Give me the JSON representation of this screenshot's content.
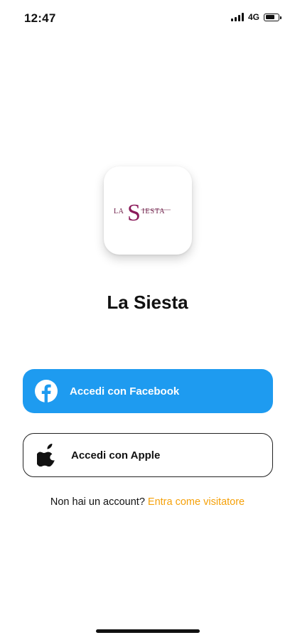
{
  "status_bar": {
    "time": "12:47",
    "network": "4G",
    "signal_bars": 4,
    "battery_level": 0.6,
    "icons": [
      "signal-icon",
      "battery-icon"
    ]
  },
  "app": {
    "logo_text": "LaSiesta",
    "name": "La Siesta",
    "logo_colors": {
      "text": "#8a1a5a"
    }
  },
  "buttons": {
    "facebook": {
      "label": "Accedi con Facebook",
      "icon": "facebook-icon",
      "color": "#1e9bf0"
    },
    "apple": {
      "label": "Accedi con Apple",
      "icon": "apple-icon",
      "color": "#ffffff"
    }
  },
  "signup": {
    "prompt": "Non hai un account?",
    "link": "Entra come visitatore",
    "link_color": "#f5a10a"
  }
}
